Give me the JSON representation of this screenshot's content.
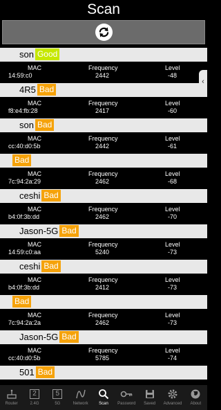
{
  "header": {
    "title": "Scan"
  },
  "colors": {
    "good": "#c6e800",
    "bad": "#f5a20a"
  },
  "labels": {
    "mac": "MAC",
    "frequency": "Frequency",
    "level": "Level"
  },
  "results": [
    {
      "ssid": "son",
      "status": "Good",
      "mac": "14:59:c0",
      "frequency": "2442",
      "level": "-48"
    },
    {
      "ssid": "4R5",
      "status": "Bad",
      "mac": "f8:e4:fb:28",
      "frequency": "2417",
      "level": "-60"
    },
    {
      "ssid": "son",
      "status": "Bad",
      "mac": "cc:40:d0:5b",
      "frequency": "2442",
      "level": "-61"
    },
    {
      "ssid": "",
      "status": "Bad",
      "mac": "7c:94:2a:29",
      "frequency": "2462",
      "level": "-68"
    },
    {
      "ssid": "ceshi",
      "status": "Bad",
      "mac": "b4:0f:3b:dd",
      "frequency": "2462",
      "level": "-70"
    },
    {
      "ssid": "Jason-5G",
      "status": "Bad",
      "mac": "14:59:c0:aa",
      "frequency": "5240",
      "level": "-73"
    },
    {
      "ssid": "ceshi",
      "status": "Bad",
      "mac": "b4:0f:3b:dd",
      "frequency": "2412",
      "level": "-73"
    },
    {
      "ssid": "",
      "status": "Bad",
      "mac": "7c:94:2a:2a",
      "frequency": "2462",
      "level": "-73"
    },
    {
      "ssid": "Jason-5G",
      "status": "Bad",
      "mac": "cc:40:d0:5b",
      "frequency": "5785",
      "level": "-74"
    },
    {
      "ssid": "501",
      "status": "Bad"
    }
  ],
  "nav": [
    {
      "label": "Router",
      "icon": "router-icon"
    },
    {
      "label": "2.4G",
      "icon": "band-2g-icon",
      "glyph": "2"
    },
    {
      "label": "5G",
      "icon": "band-5g-icon",
      "glyph": "5"
    },
    {
      "label": "Network",
      "icon": "network-icon"
    },
    {
      "label": "Scan",
      "icon": "scan-icon",
      "active": true
    },
    {
      "label": "Password",
      "icon": "key-icon"
    },
    {
      "label": "Saved",
      "icon": "saved-icon"
    },
    {
      "label": "Advanced",
      "icon": "gear-icon"
    },
    {
      "label": "About",
      "icon": "globe-icon"
    }
  ]
}
